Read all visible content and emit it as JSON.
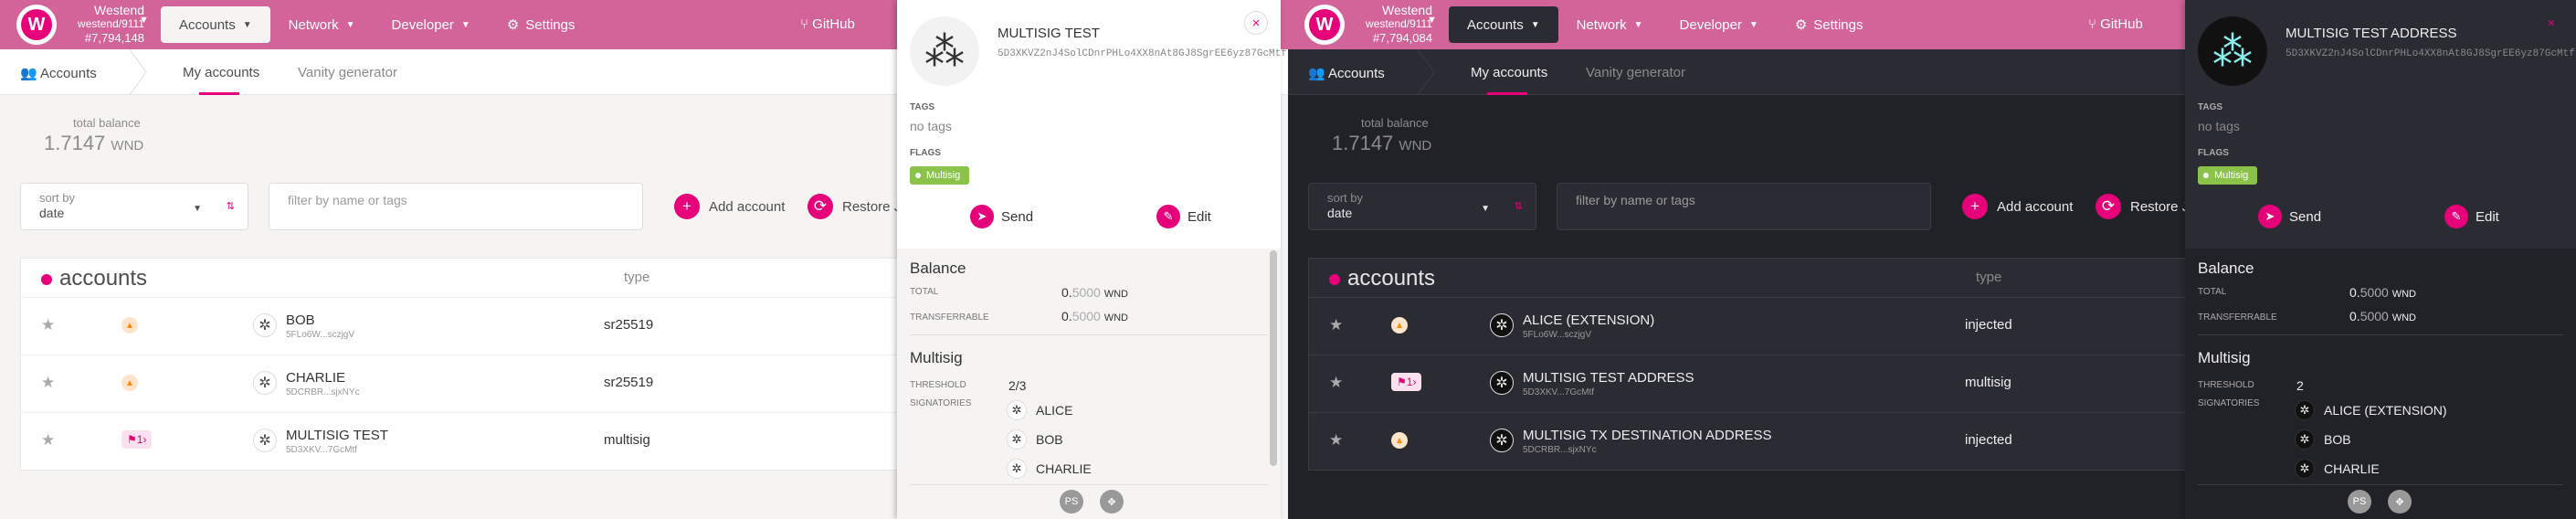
{
  "light": {
    "chain": {
      "name": "Westend",
      "sub": "westend/9111",
      "block": "#7,794,148"
    },
    "menu": {
      "accounts": "Accounts",
      "network": "Network",
      "developer": "Developer",
      "settings": "Settings",
      "github": "GitHub"
    },
    "subnav": {
      "accounts": "Accounts",
      "my_accounts": "My accounts",
      "vanity": "Vanity generator"
    },
    "balance": {
      "label": "total balance",
      "int": "1.7147",
      "unit": "WND"
    },
    "sort": {
      "label": "sort by",
      "value": "date"
    },
    "filter": {
      "placeholder": "filter by name or tags"
    },
    "buttons": {
      "add": "Add account",
      "restore": "Restore JS"
    },
    "table": {
      "title": "accounts",
      "type_header": "type",
      "rows": [
        {
          "name": "BOB",
          "addr": "5FLo6W...sczjgV",
          "type": "sr25519",
          "badge": "warn"
        },
        {
          "name": "CHARLIE",
          "addr": "5DCRBR...sjxNYc",
          "type": "sr25519",
          "badge": "warn"
        },
        {
          "name": "MULTISIG TEST",
          "addr": "5D3XKV...7GcMtf",
          "type": "multisig",
          "badge": "1"
        }
      ]
    },
    "side": {
      "title": "MULTISIG TEST",
      "address": "5D3XKVZ2nJ4SolCDnrPHLo4XX8nAt8GJ8SgrEE6yz87GcMtf",
      "tags_label": "TAGS",
      "no_tags": "no tags",
      "flags_label": "FLAGS",
      "flag": "Multisig",
      "send": "Send",
      "edit": "Edit",
      "balance_h": "Balance",
      "total_l": "TOTAL",
      "total_v1": "0.",
      "total_v2": "5000",
      "total_u": "WND",
      "trans_l": "TRANSFERRABLE",
      "trans_v1": "0.",
      "trans_v2": "5000",
      "trans_u": "WND",
      "multisig_h": "Multisig",
      "threshold_l": "THRESHOLD",
      "threshold_v": "2/3",
      "signatories_l": "SIGNATORIES",
      "signatories": [
        "ALICE",
        "BOB",
        "CHARLIE"
      ]
    }
  },
  "dark": {
    "chain": {
      "name": "Westend",
      "sub": "westend/9111",
      "block": "#7,794,084"
    },
    "menu": {
      "accounts": "Accounts",
      "network": "Network",
      "developer": "Developer",
      "settings": "Settings",
      "github": "GitHub"
    },
    "subnav": {
      "accounts": "Accounts",
      "my_accounts": "My accounts",
      "vanity": "Vanity generator"
    },
    "balance": {
      "label": "total balance",
      "int": "1.7147",
      "unit": "WND"
    },
    "sort": {
      "label": "sort by",
      "value": "date"
    },
    "filter": {
      "placeholder": "filter by name or tags"
    },
    "buttons": {
      "add": "Add account",
      "restore": "Restore JS"
    },
    "table": {
      "title": "accounts",
      "type_header": "type",
      "rows": [
        {
          "name": "ALICE (EXTENSION)",
          "addr": "5FLo6W...sczjgV",
          "type": "injected",
          "badge": "warn"
        },
        {
          "name": "MULTISIG TEST ADDRESS",
          "addr": "5D3XKV...7GcMtf",
          "type": "multisig",
          "badge": "1"
        },
        {
          "name": "MULTISIG TX DESTINATION ADDRESS",
          "addr": "5DCRBR...sjxNYc",
          "type": "injected",
          "badge": "warn"
        }
      ]
    },
    "side": {
      "title": "MULTISIG TEST ADDRESS",
      "address": "5D3XKVZ2nJ4SolCDnrPHLo4XX8nAt8GJ8SgrEE6yz87GcMtf",
      "tags_label": "TAGS",
      "no_tags": "no tags",
      "flags_label": "FLAGS",
      "flag": "Multisig",
      "send": "Send",
      "edit": "Edit",
      "balance_h": "Balance",
      "total_l": "TOTAL",
      "total_v1": "0.",
      "total_v2": "5000",
      "total_u": "WND",
      "trans_l": "TRANSFERRABLE",
      "trans_v1": "0.",
      "trans_v2": "5000",
      "trans_u": "WND",
      "multisig_h": "Multisig",
      "threshold_l": "THRESHOLD",
      "threshold_v": "2",
      "signatories_l": "SIGNATORIES",
      "signatories": [
        "ALICE (EXTENSION)",
        "BOB",
        "CHARLIE"
      ]
    }
  },
  "colors": {
    "brand": "#e6007a",
    "topbar": "#d2649a",
    "flag": "#8bc34a"
  }
}
